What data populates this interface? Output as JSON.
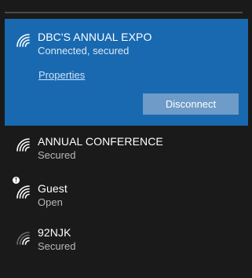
{
  "networks": {
    "active": {
      "name": "DBC'S ANNUAL EXPO",
      "status": "Connected, secured",
      "properties_label": "Properties",
      "disconnect_label": "Disconnect",
      "icon": "wifi-signal-icon",
      "highlight_color": "#1869b0"
    },
    "list": [
      {
        "name": "ANNUAL CONFERENCE",
        "status": "Secured",
        "icon": "wifi-signal-icon"
      },
      {
        "name": "Guest",
        "status": "Open",
        "icon": "wifi-open-warning-icon"
      },
      {
        "name": "92NJK",
        "status": "Secured",
        "icon": "wifi-signal-icon"
      }
    ]
  }
}
